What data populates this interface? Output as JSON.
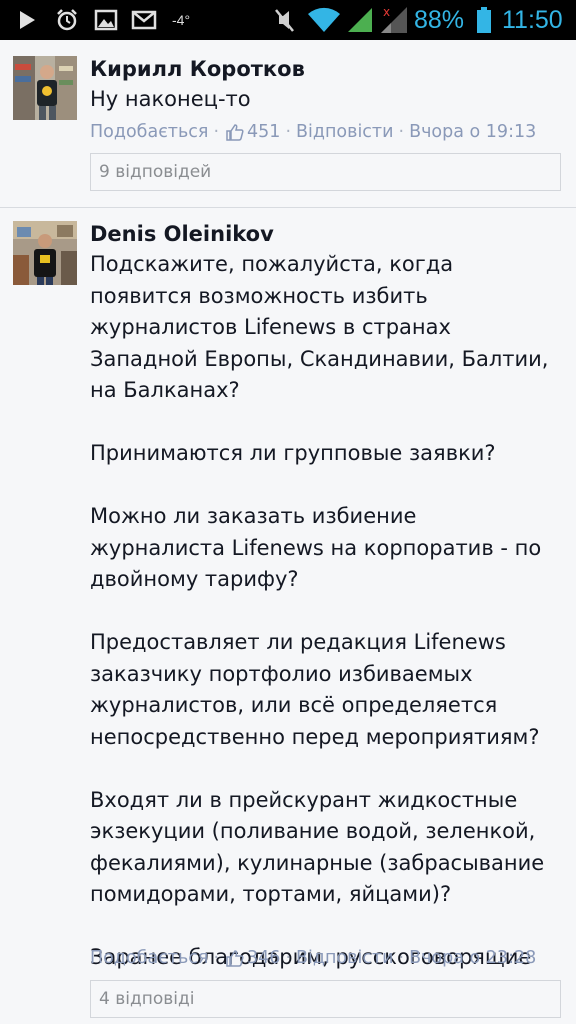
{
  "status_bar": {
    "temperature": "-4°",
    "battery_percent": "88%",
    "battery_level": 0.88,
    "time": "11:50",
    "icons": [
      "play-icon",
      "alarm-icon",
      "picture-icon",
      "mail-icon",
      "mute-icon",
      "wifi-icon",
      "signal-icon",
      "signal-icon",
      "battery-icon"
    ],
    "accent_color": "#33b5e5"
  },
  "comments": [
    {
      "author": "Кирилл Коротков",
      "text": "Ну наконец-то",
      "like_label": "Подобається",
      "like_count": "451",
      "reply_label": "Відповісти",
      "time": "Вчора о 19:13",
      "replies_label": "9 відповідей"
    },
    {
      "author": "Denis Oleinikov",
      "text": "Подскажите, пожалуйста, когда\nпоявится возможность избить\nжурналистов Lifenews в странах\nЗападной Европы, Скандинавии, Балтии,\nна Балканах?\n\nПринимаются ли групповые заявки?\n\nМожно ли заказать избиение\nжурналиста Lifenews на корпоратив - по\nдвойному тарифу?\n\nПредоставляет ли редакция Lifenews\nзаказчику портфолио избиваемых\nжурналистов, или всё определяется\nнепосредственно перед мероприятиям?\n\nВходят ли в прейскурант жидкостные\nэкзекуции (поливание водой, зеленкой,\nфекалиями), кулинарные (забрасывание\nпомидорами, тортами, яйцами)?\n\nЗаранее благодарим, русскоговорящие\nукраинцы.",
      "like_label": "Подобається",
      "like_count": "346",
      "reply_label": "Відповісти",
      "time": "Вчора о 23:28",
      "replies_label": "4 відповіді"
    }
  ]
}
